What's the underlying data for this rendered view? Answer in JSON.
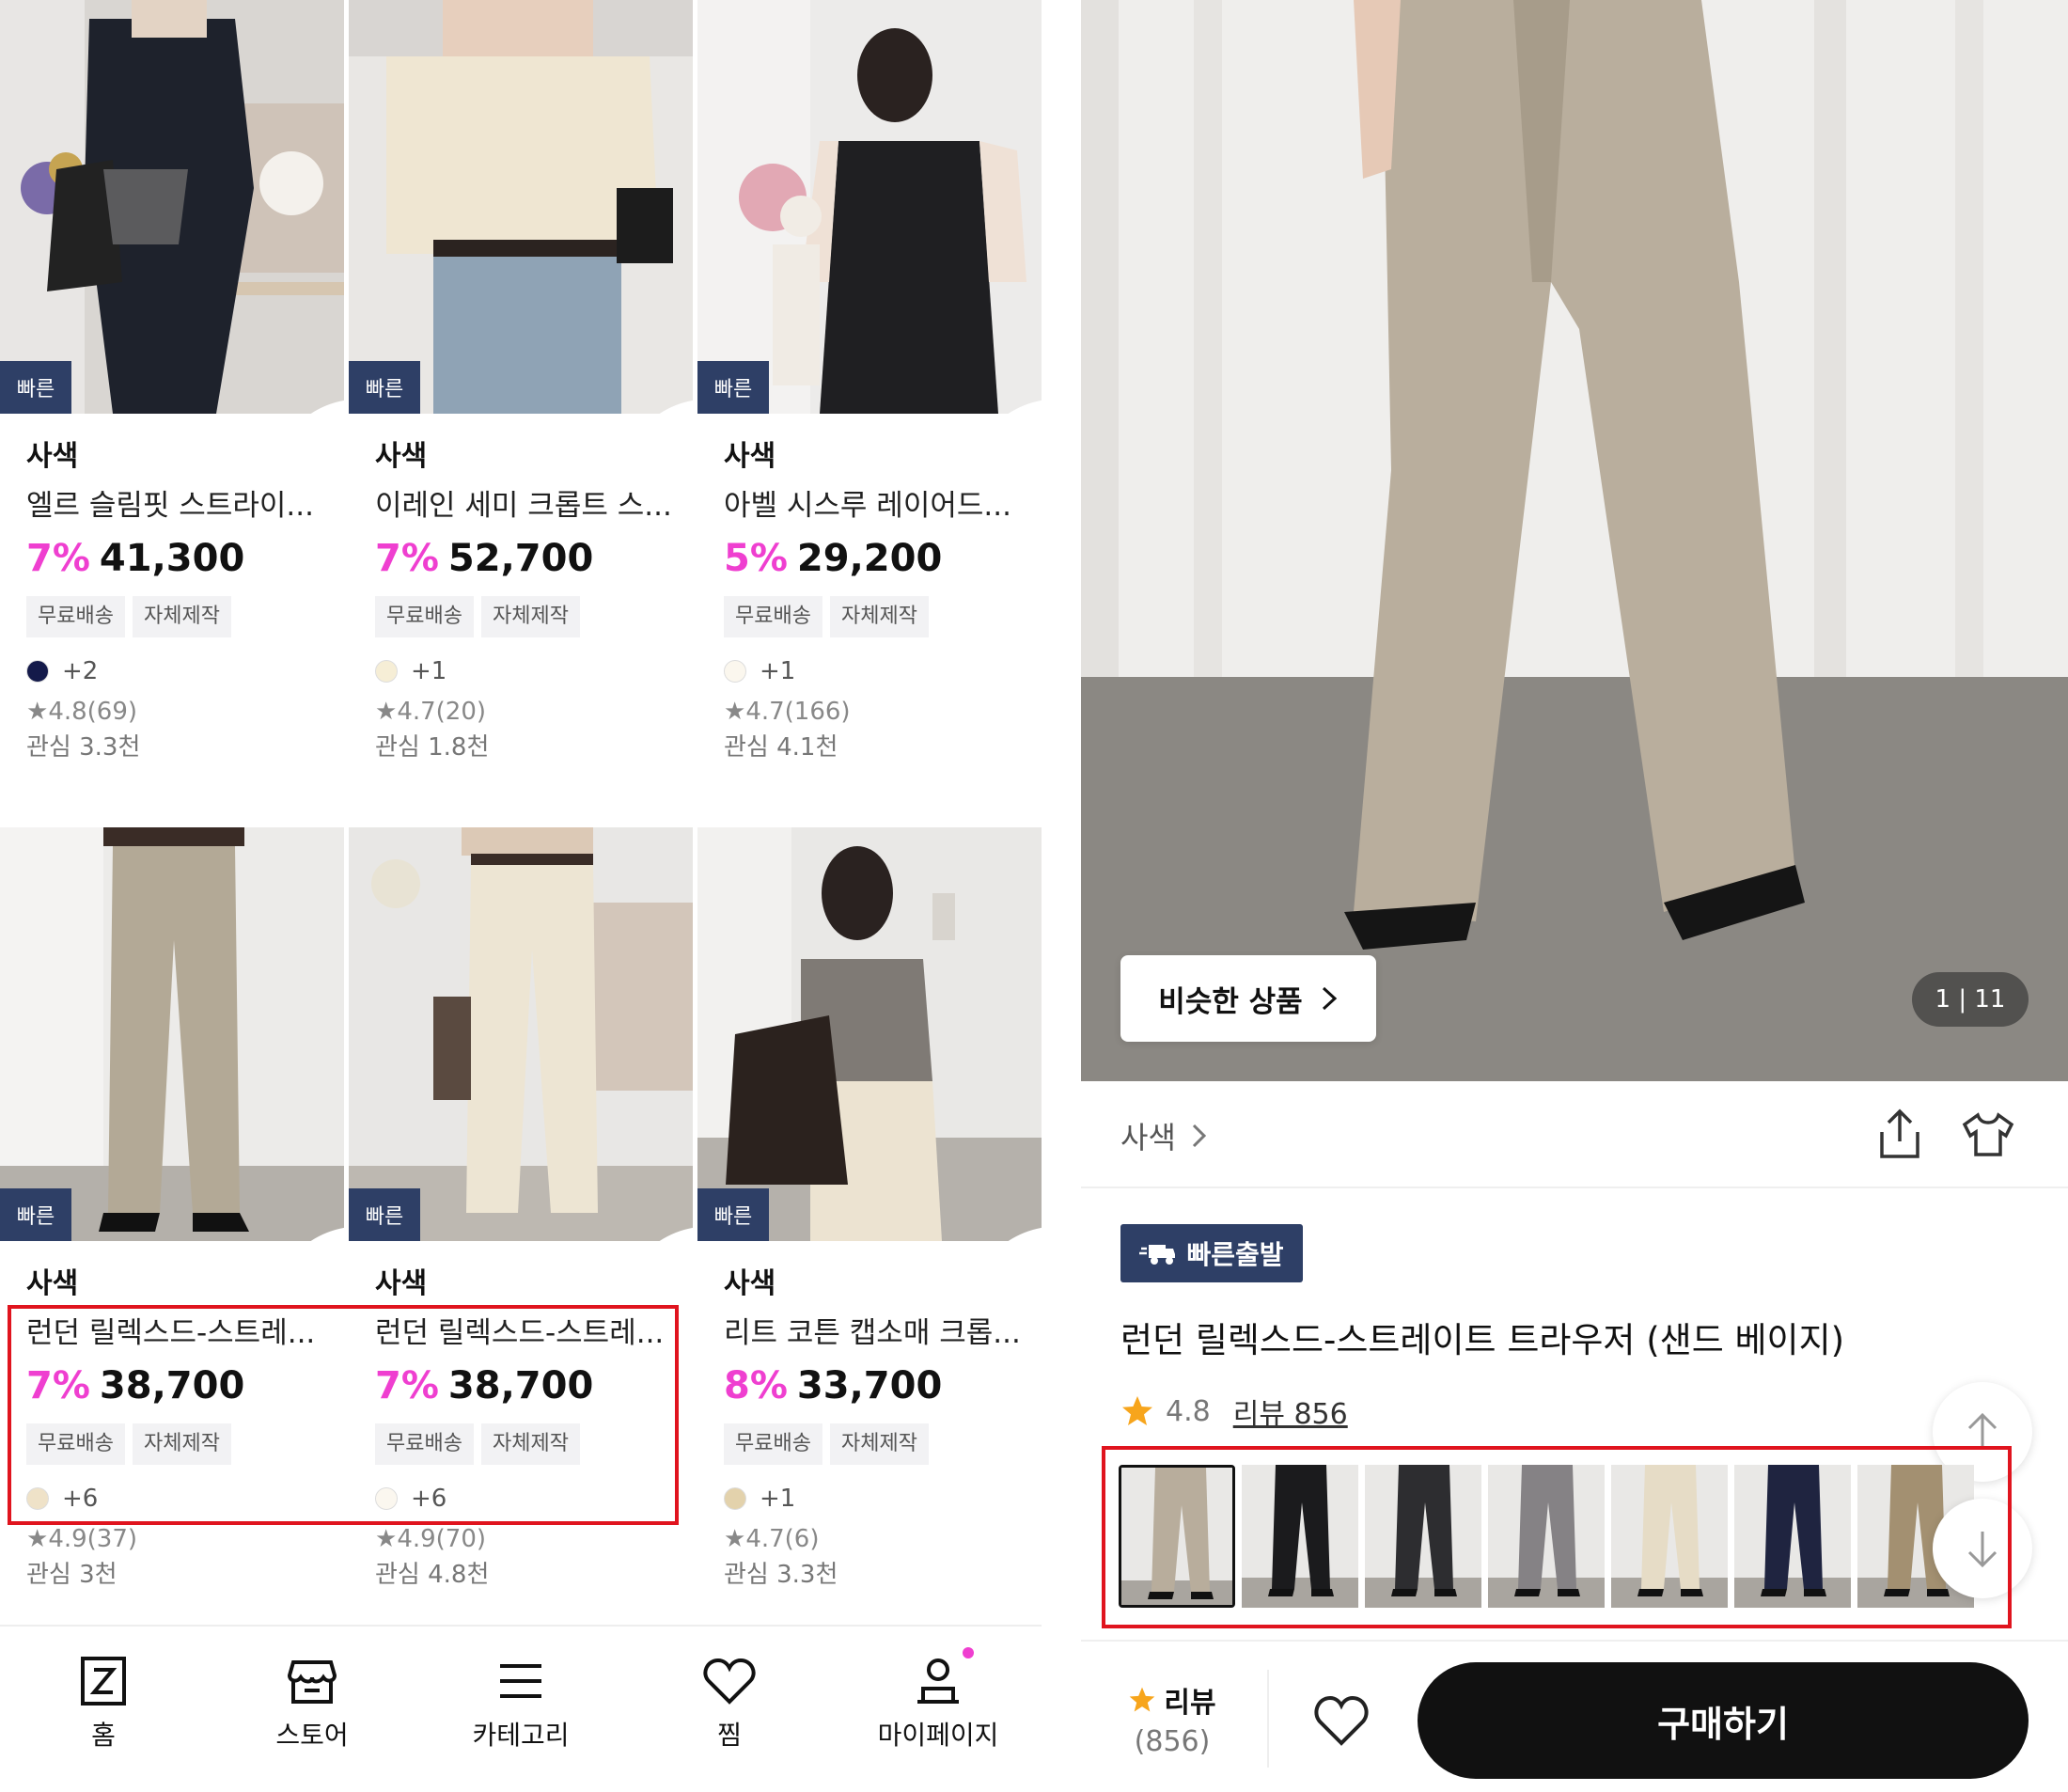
{
  "listing": {
    "fast_badge": "빠른",
    "cards": [
      {
        "brand": "사색",
        "name": "엘르 슬림핏 스트라이...",
        "discount": "7%",
        "price": "41,300",
        "tags": [
          "무료배송",
          "자체제작"
        ],
        "color_dot": "#141a4a",
        "color_more": "+2",
        "rating": "4.8(69)",
        "likes": "관심 3.3천"
      },
      {
        "brand": "사색",
        "name": "이레인 세미 크롭트 스...",
        "discount": "7%",
        "price": "52,700",
        "tags": [
          "무료배송",
          "자체제작"
        ],
        "color_dot": "#f6eed6",
        "color_more": "+1",
        "rating": "4.7(20)",
        "likes": "관심 1.8천"
      },
      {
        "brand": "사색",
        "name": "아벨 시스루 레이어드...",
        "discount": "5%",
        "price": "29,200",
        "tags": [
          "무료배송",
          "자체제작"
        ],
        "color_dot": "#fbf7ee",
        "color_more": "+1",
        "rating": "4.7(166)",
        "likes": "관심 4.1천"
      },
      {
        "brand": "사색",
        "name": "런던 릴렉스드-스트레...",
        "discount": "7%",
        "price": "38,700",
        "tags": [
          "무료배송",
          "자체제작"
        ],
        "color_dot": "#efe2c8",
        "color_more": "+6",
        "rating": "4.9(37)",
        "likes": "관심 3천"
      },
      {
        "brand": "사색",
        "name": "런던 릴렉스드-스트레...",
        "discount": "7%",
        "price": "38,700",
        "tags": [
          "무료배송",
          "자체제작"
        ],
        "color_dot": "#fbf7ef",
        "color_more": "+6",
        "rating": "4.9(70)",
        "likes": "관심 4.8천"
      },
      {
        "brand": "사색",
        "name": "리트 코튼 캡소매 크롭...",
        "discount": "8%",
        "price": "33,700",
        "tags": [
          "무료배송",
          "자체제작"
        ],
        "color_dot": "#e3d2ac",
        "color_more": "+1",
        "rating": "4.7(6)",
        "likes": "관심 3.3천"
      }
    ]
  },
  "bottom_nav": {
    "items": [
      {
        "label": "홈",
        "icon": "home-z-icon"
      },
      {
        "label": "스토어",
        "icon": "store-icon"
      },
      {
        "label": "카테고리",
        "icon": "menu-icon"
      },
      {
        "label": "찜",
        "icon": "heart-icon"
      },
      {
        "label": "마이페이지",
        "icon": "person-icon"
      }
    ]
  },
  "detail": {
    "similar_label": "비슷한 상품",
    "counter": "1 | 11",
    "brand": "사색",
    "fast_label": "빠른출발",
    "title": "런던 릴렉스드-스트레이트 트라우저 (샌드 베이지)",
    "rating": "4.8",
    "review_link": "리뷰 856",
    "review_label": "리뷰",
    "review_count": "(856)",
    "buy_label": "구매하기",
    "thumbnails": [
      "#b8ad9c",
      "#1b1b1d",
      "#2d2d30",
      "#858285",
      "#e6dcc6",
      "#1f2440",
      "#a39071"
    ]
  },
  "colors": {
    "accent_pink": "#ef3fd0",
    "badge_navy": "#2e3f66",
    "highlight_red": "#e0141e",
    "star": "#f7a51c"
  }
}
